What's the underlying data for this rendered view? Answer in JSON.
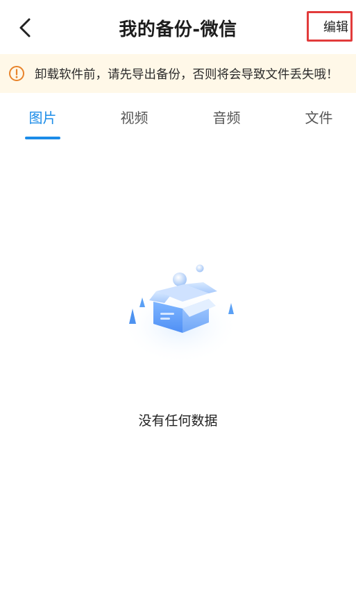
{
  "header": {
    "title": "我的备份-微信",
    "edit_label": "编辑",
    "back_icon": "chevron-left-icon"
  },
  "banner": {
    "icon": "warning-circle-icon",
    "text": "卸载软件前，请先导出备份，否则将会导致文件丢失哦！",
    "background": "#fff8e8",
    "icon_color": "#e8832a"
  },
  "tabs": [
    {
      "label": "图片",
      "active": true
    },
    {
      "label": "视频",
      "active": false
    },
    {
      "label": "音频",
      "active": false
    },
    {
      "label": "文件",
      "active": false
    }
  ],
  "accent_color": "#1b8ce8",
  "empty_state": {
    "icon": "empty-box-icon",
    "text": "没有任何数据"
  }
}
